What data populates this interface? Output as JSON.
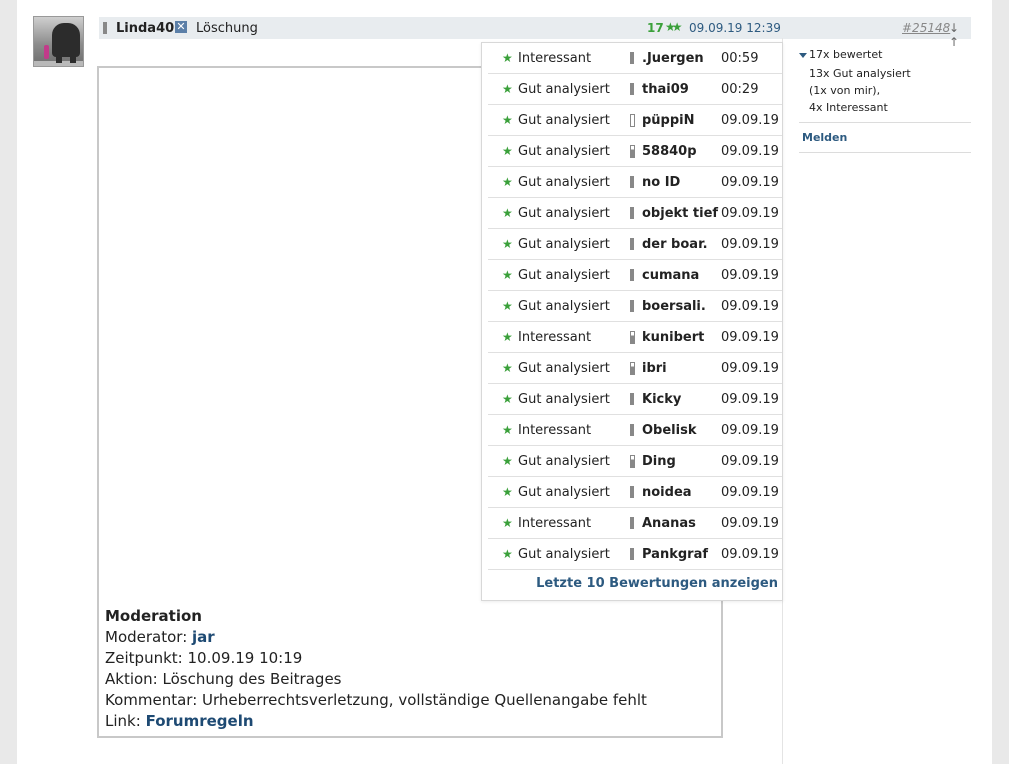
{
  "post": {
    "author": "Linda40:",
    "title": "Löschung",
    "rating_count": "17",
    "rating_icon": "double-star-icon",
    "date": "09.09.19 12:39",
    "post_number": "#25148",
    "nav_arrows": "↓ ↑"
  },
  "ratings_popup": {
    "rows": [
      {
        "type": "Interessant",
        "user": ".Juergen",
        "time": "00:59",
        "bar": "full"
      },
      {
        "type": "Gut analysiert",
        "user": "thai09",
        "time": "00:29",
        "bar": "full"
      },
      {
        "type": "Gut analysiert",
        "user": "püppiN",
        "time": "09.09.19",
        "bar": "hollow"
      },
      {
        "type": "Gut analysiert",
        "user": "58840p",
        "time": "09.09.19",
        "bar": "half"
      },
      {
        "type": "Gut analysiert",
        "user": "no ID",
        "time": "09.09.19",
        "bar": "full"
      },
      {
        "type": "Gut analysiert",
        "user": "objekt tief",
        "time": "09.09.19",
        "bar": "full"
      },
      {
        "type": "Gut analysiert",
        "user": "der boar.",
        "time": "09.09.19",
        "bar": "full"
      },
      {
        "type": "Gut analysiert",
        "user": "cumana",
        "time": "09.09.19",
        "bar": "full"
      },
      {
        "type": "Gut analysiert",
        "user": "boersali.",
        "time": "09.09.19",
        "bar": "full"
      },
      {
        "type": "Interessant",
        "user": "kunibert",
        "time": "09.09.19",
        "bar": "half"
      },
      {
        "type": "Gut analysiert",
        "user": "ibri",
        "time": "09.09.19",
        "bar": "half"
      },
      {
        "type": "Gut analysiert",
        "user": "Kicky",
        "time": "09.09.19",
        "bar": "full"
      },
      {
        "type": "Interessant",
        "user": "Obelisk",
        "time": "09.09.19",
        "bar": "full"
      },
      {
        "type": "Gut analysiert",
        "user": "Ding",
        "time": "09.09.19",
        "bar": "half"
      },
      {
        "type": "Gut analysiert",
        "user": "noidea",
        "time": "09.09.19",
        "bar": "full"
      },
      {
        "type": "Interessant",
        "user": "Ananas",
        "time": "09.09.19",
        "bar": "full"
      },
      {
        "type": "Gut analysiert",
        "user": "Pankgraf",
        "time": "09.09.19",
        "bar": "full"
      }
    ],
    "more_link": "Letzte 10 Bewertungen anzeigen"
  },
  "moderation": {
    "title": "Moderation",
    "moderator_label": "Moderator:",
    "moderator": "jar",
    "time_label": "Zeitpunkt:",
    "time": "10.09.19 10:19",
    "action_label": "Aktion:",
    "action": "Löschung des Beitrages",
    "comment_label": "Kommentar:",
    "comment": "Urheberrechtsverletzung, vollständige Quellenangabe fehlt",
    "link_label": "Link:",
    "link": "Forumregeln"
  },
  "sidebar": {
    "summary": "17x bewertet",
    "details": [
      "13x Gut analysiert",
      "(1x von mir),",
      "4x Interessant"
    ],
    "report": "Melden"
  },
  "colors": {
    "accent": "#2d5a80",
    "star": "#3aa03a",
    "header_bg": "#e8ecef"
  }
}
